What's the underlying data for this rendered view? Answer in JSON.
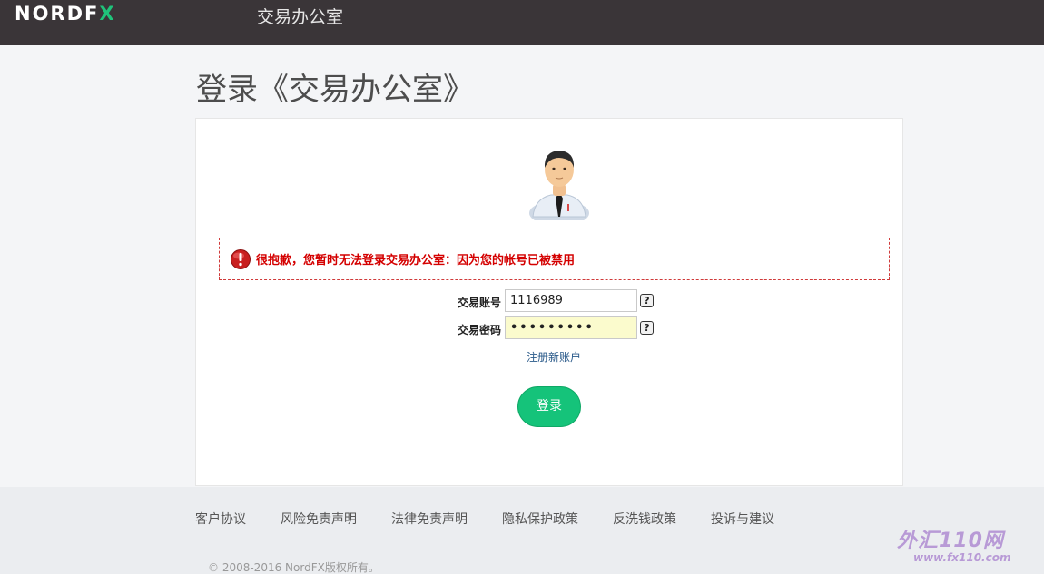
{
  "header": {
    "logo_left": "NORD ",
    "logo_right": "F",
    "logo_x": "X",
    "title": "交易办公室"
  },
  "page": {
    "title": "登录《交易办公室》"
  },
  "error": {
    "message": "很抱歉，您暂时无法登录交易办公室：因为您的帐号已被禁用"
  },
  "form": {
    "account_label": "交易账号",
    "account_value": "1116989",
    "password_label": "交易密码",
    "password_value": "•••••••••",
    "help_glyph": "?",
    "register_label": "注册新账户",
    "login_label": "登录"
  },
  "footer": {
    "links": [
      "客户协议",
      "风险免责声明",
      "法律免责声明",
      "隐私保护政策",
      "反洗钱政策",
      "投诉与建议"
    ],
    "copyright": "© 2008-2016 NordFX版权所有。"
  },
  "watermark": {
    "main": "外汇110网",
    "url": "www.fx110.com"
  },
  "colors": {
    "header_bg": "#3a3538",
    "accent": "#15c37a",
    "error": "#d40000"
  }
}
